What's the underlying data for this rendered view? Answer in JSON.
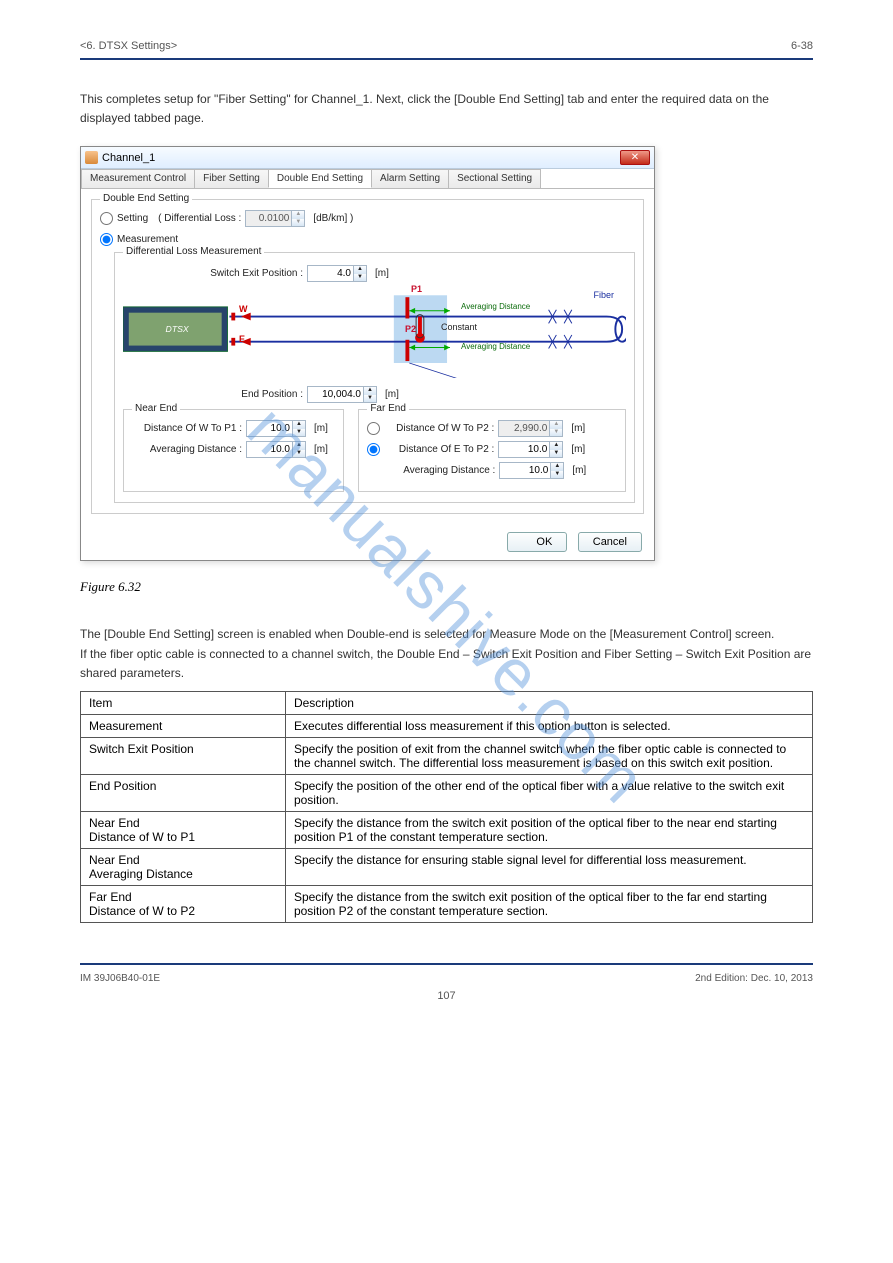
{
  "header": {
    "left": "<6. DTSX Settings>",
    "right": "6-38"
  },
  "intro": "This completes setup for \"Fiber Setting\" for Channel_1. Next, click the [Double End Setting] tab and enter the required data on the displayed tabbed page.",
  "figure_caption": "Figure 6.32",
  "watermark": "manualshive.com",
  "dialog": {
    "title": "Channel_1",
    "tabs": [
      "Measurement Control",
      "Fiber Setting",
      "Double End Setting",
      "Alarm Setting",
      "Sectional Setting"
    ],
    "active_tab_index": 2,
    "group_legend": "Double End Setting",
    "radio_setting_label": "Setting",
    "diff_loss_label": "( Differential Loss :",
    "diff_loss_value": "0.0100",
    "diff_loss_unit": "[dB/km] )",
    "radio_measurement_label": "Measurement",
    "dlm_legend": "Differential Loss Measurement",
    "switch_exit_label": "Switch Exit Position :",
    "switch_exit_value": "4.0",
    "switch_exit_unit": "[m]",
    "end_position_label": "End Position :",
    "end_position_value": "10,004.0",
    "end_position_unit": "[m]",
    "diagram": {
      "p1": "P1",
      "p2": "P2",
      "w": "W",
      "e": "E",
      "avg": "Averaging Distance",
      "constant": "Constant",
      "fiber": "Fiber"
    },
    "near_end": {
      "legend": "Near End",
      "dist_label": "Distance Of W To P1 :",
      "dist_value": "10.0",
      "dist_unit": "[m]",
      "avg_label": "Averaging Distance :",
      "avg_value": "10.0",
      "avg_unit": "[m]"
    },
    "far_end": {
      "legend": "Far End",
      "opt1_label": "Distance Of W To P2 :",
      "opt1_value": "2,990.0",
      "opt1_unit": "[m]",
      "opt2_label": "Distance Of E To P2 :",
      "opt2_value": "10.0",
      "opt2_unit": "[m]",
      "avg_label": "Averaging Distance :",
      "avg_value": "10.0",
      "avg_unit": "[m]"
    },
    "ok_label": "OK",
    "cancel_label": "Cancel"
  },
  "notes": "The [Double End Setting] screen is enabled when Double-end is selected for Measure Mode on the [Measurement Control] screen.\nIf the fiber optic cable is connected to a channel switch, the Double End – Switch Exit Position and Fiber Setting – Switch Exit Position are shared parameters.",
  "table": {
    "header": [
      "Item",
      "Description"
    ],
    "rows": [
      [
        "Measurement",
        "Executes differential loss measurement if this option button is selected."
      ],
      [
        "Switch Exit Position",
        "Specify the position of exit from the channel switch when the fiber optic cable is connected to the channel switch. The differential loss measurement is based on this switch exit position."
      ],
      [
        "End Position",
        "Specify the position of the other end of the optical fiber with a value relative to the switch exit position."
      ],
      [
        "Near End\nDistance of W to P1",
        "Specify the distance from the switch exit position of the optical fiber to the near end starting position P1 of the constant temperature section."
      ],
      [
        "Near End\nAveraging Distance",
        "Specify the distance for ensuring stable signal level for differential loss measurement."
      ],
      [
        "Far End\nDistance of W to P2",
        "Specify the distance from the switch exit position of the optical fiber to the far end starting position P2 of the constant temperature section."
      ]
    ]
  },
  "footer": {
    "left": "IM 39J06B40-01E",
    "right": "2nd Edition: Dec. 10, 2013"
  },
  "page_number": "107"
}
